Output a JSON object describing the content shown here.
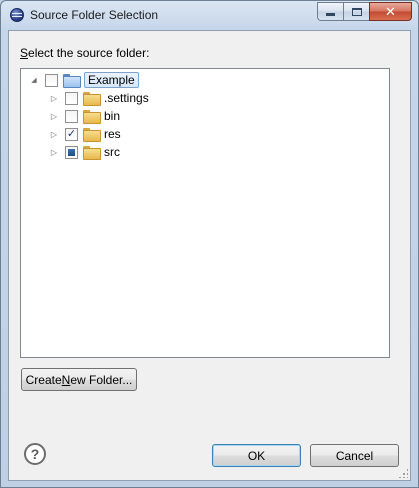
{
  "window": {
    "title": "Source Folder Selection"
  },
  "caption": {
    "minimize_icon": "minimize-icon",
    "maximize_icon": "maximize-icon",
    "close_glyph": "✕"
  },
  "dialog": {
    "prompt_underlined": "S",
    "prompt_rest": "elect the source folder:"
  },
  "tree": {
    "root": {
      "label": "Example",
      "expanded": true,
      "checked": false
    },
    "children": [
      {
        "label": ".settings",
        "checked": false,
        "state": "unchecked"
      },
      {
        "label": "bin",
        "checked": false,
        "state": "unchecked"
      },
      {
        "label": "res",
        "checked": true,
        "state": "checked"
      },
      {
        "label": "src",
        "checked": false,
        "state": "partial"
      }
    ],
    "collapse_glyph": "◢",
    "expand_glyph": "▷",
    "check_glyph": "✓"
  },
  "buttons": {
    "create_pre": "Create ",
    "create_underlined": "N",
    "create_post": "ew Folder...",
    "ok": "OK",
    "cancel": "Cancel",
    "help_glyph": "?"
  },
  "colors": {
    "default_button_border": "#3c7fb1",
    "close_button": "#c14a32",
    "selection_border": "#7da2ce"
  }
}
